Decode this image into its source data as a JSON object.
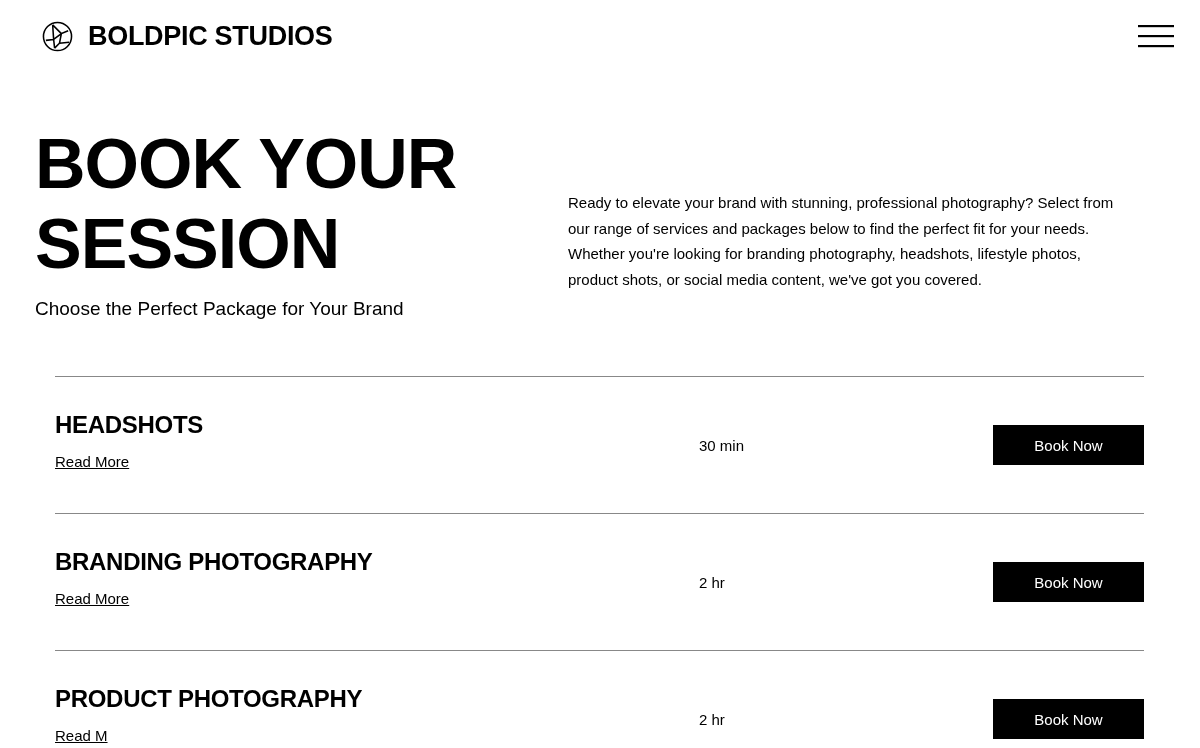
{
  "header": {
    "brand": "BOLDPIC STUDIOS"
  },
  "hero": {
    "title": "BOOK YOUR SESSION",
    "subtitle": "Choose the Perfect Package for Your Brand",
    "description": "Ready to elevate your brand with stunning, professional photography? Select from our range of services and packages below to find the perfect fit for your needs. Whether you're looking for branding photography, headshots, lifestyle photos, product shots, or social media content, we've got you covered."
  },
  "services": [
    {
      "name": "HEADSHOTS",
      "link": "Read More",
      "duration": "30 min",
      "button": "Book Now"
    },
    {
      "name": "BRANDING PHOTOGRAPHY",
      "link": "Read More",
      "duration": "2 hr",
      "button": "Book Now"
    },
    {
      "name": "PRODUCT PHOTOGRAPHY",
      "link": "Read M",
      "duration": "2 hr",
      "button": "Book Now"
    }
  ]
}
